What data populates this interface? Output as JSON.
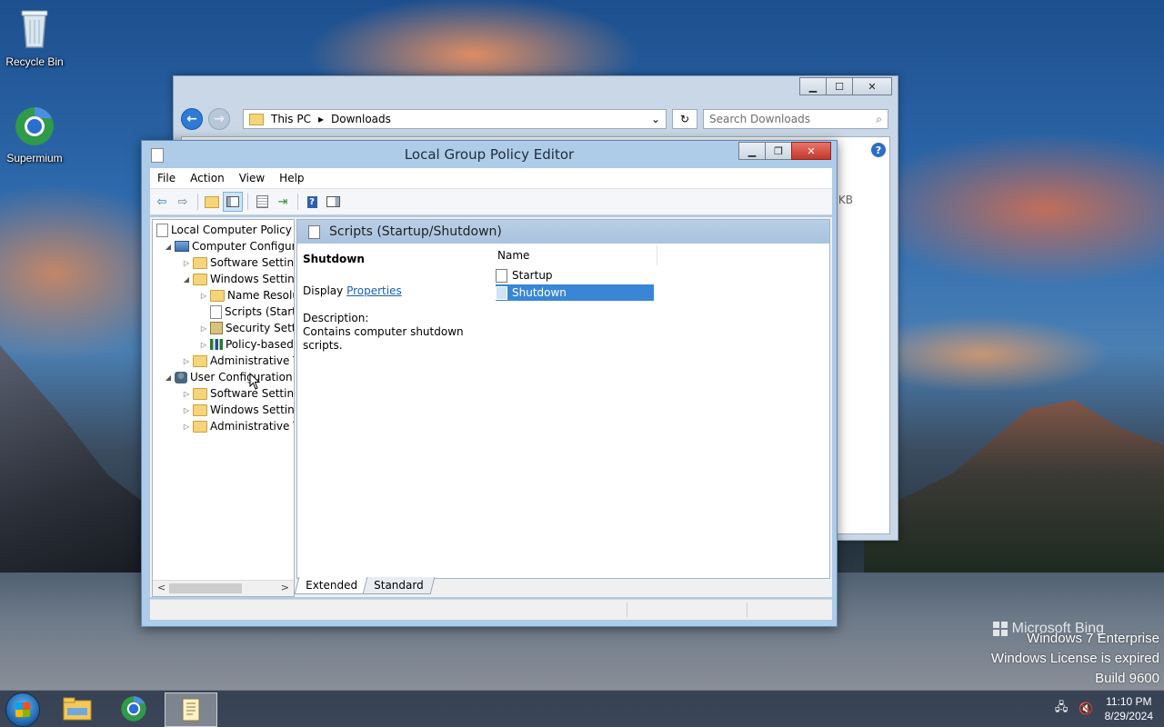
{
  "desktop": {
    "icons": [
      {
        "label": "Recycle Bin",
        "icon": "recycle-bin-icon"
      },
      {
        "label": "Supermium",
        "icon": "supermium-browser-icon"
      }
    ],
    "watermark": [
      "Windows 7 Enterprise",
      "Windows License is expired",
      "Build 9600"
    ],
    "bing": "Microsoft Bing"
  },
  "explorer": {
    "path": [
      "This PC",
      "Downloads"
    ],
    "search_placeholder": "Search Downloads",
    "partial_size": "KB"
  },
  "gpedit": {
    "title": "Local Group Policy Editor",
    "menu": [
      "File",
      "Action",
      "View",
      "Help"
    ],
    "tree": [
      {
        "label": "Local Computer Policy",
        "level": 0,
        "expander": "",
        "icon": "doc"
      },
      {
        "label": "Computer Configura",
        "level": 1,
        "expander": "expanded",
        "icon": "comp"
      },
      {
        "label": "Software Settings",
        "level": 2,
        "expander": "collapsed",
        "icon": "folder"
      },
      {
        "label": "Windows Setting",
        "level": 2,
        "expander": "expanded",
        "icon": "folder"
      },
      {
        "label": "Name Resolu",
        "level": 3,
        "expander": "collapsed",
        "icon": "folder"
      },
      {
        "label": "Scripts (Startu",
        "level": 3,
        "expander": "",
        "icon": "doc"
      },
      {
        "label": "Security Settin",
        "level": 3,
        "expander": "collapsed",
        "icon": "lock"
      },
      {
        "label": "Policy-based",
        "level": 3,
        "expander": "collapsed",
        "icon": "bars"
      },
      {
        "label": "Administrative Te",
        "level": 2,
        "expander": "collapsed",
        "icon": "folder"
      },
      {
        "label": "User Configuration",
        "level": 1,
        "expander": "expanded",
        "icon": "user"
      },
      {
        "label": "Software Settings",
        "level": 2,
        "expander": "collapsed",
        "icon": "folder"
      },
      {
        "label": "Windows Setting",
        "level": 2,
        "expander": "collapsed",
        "icon": "folder"
      },
      {
        "label": "Administrative Te",
        "level": 2,
        "expander": "collapsed",
        "icon": "folder"
      }
    ],
    "pane_title": "Scripts (Startup/Shutdown)",
    "extended": {
      "heading": "Shutdown",
      "display_prefix": "Display",
      "properties_link": "Properties",
      "description_label": "Description:",
      "description": "Contains computer shutdown scripts."
    },
    "list": {
      "column": "Name",
      "items": [
        {
          "label": "Startup",
          "selected": false
        },
        {
          "label": "Shutdown",
          "selected": true
        }
      ]
    },
    "tabs": [
      {
        "label": "Extended",
        "active": true
      },
      {
        "label": "Standard",
        "active": false
      }
    ]
  },
  "taskbar": {
    "time": "11:10 PM",
    "date": "8/29/2024"
  }
}
